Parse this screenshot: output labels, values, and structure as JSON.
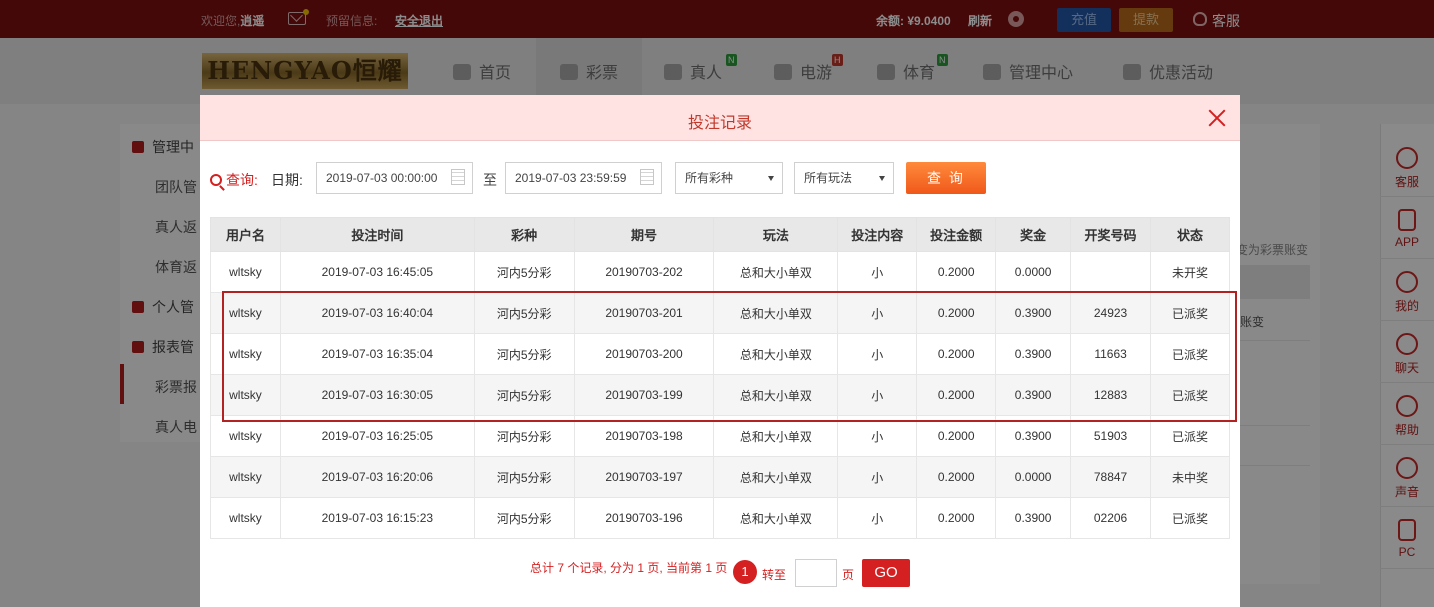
{
  "topbar": {
    "welcome": "欢迎您,",
    "username": "逍遥",
    "notice_label": "预留信息:",
    "logout": "安全退出",
    "balance": "余额: ¥9.0400",
    "refresh": "刷新",
    "recharge": "充值",
    "withdraw": "提款",
    "service": "客服"
  },
  "nav": {
    "logo": "HENGYAO恒耀",
    "items": [
      {
        "label": "首页",
        "icon": "home-icon"
      },
      {
        "label": "彩票",
        "icon": "lottery-ticket-icon"
      },
      {
        "label": "真人",
        "icon": "live-dealer-icon",
        "badge": "N"
      },
      {
        "label": "电游",
        "icon": "game-console-icon",
        "badge": "H"
      },
      {
        "label": "体育",
        "icon": "trophy-icon",
        "badge": "N"
      },
      {
        "label": "管理中心",
        "icon": "users-icon"
      },
      {
        "label": "优惠活动",
        "icon": "gift-icon"
      }
    ]
  },
  "background": {
    "side": [
      "管理中",
      "团队管",
      "真人返",
      "体育返",
      "个人管",
      "报表管",
      "彩票报",
      "真人电"
    ],
    "main_fragments": [
      "变为彩票账变",
      "账变"
    ]
  },
  "dock": [
    {
      "label": "客服",
      "icon": "customer-service-icon"
    },
    {
      "label": "APP",
      "icon": "phone-icon"
    },
    {
      "label": "我的",
      "icon": "user-icon"
    },
    {
      "label": "聊天",
      "icon": "chat-icon"
    },
    {
      "label": "帮助",
      "icon": "help-icon"
    },
    {
      "label": "声音",
      "icon": "speaker-icon"
    },
    {
      "label": "PC",
      "icon": "monitor-icon"
    }
  ],
  "modal": {
    "title": "投注记录",
    "filters": {
      "query_label": "查询:",
      "date_label": "日期:",
      "start_date": "2019-07-03 00:00:00",
      "to_label": "至",
      "end_date": "2019-07-03 23:59:59",
      "lottery_type": "所有彩种",
      "play_type": "所有玩法",
      "submit": "查 询"
    },
    "table": {
      "headers": [
        "用户名",
        "投注时间",
        "彩种",
        "期号",
        "玩法",
        "投注内容",
        "投注金额",
        "奖金",
        "开奖号码",
        "状态"
      ],
      "rows": [
        [
          "wltsky",
          "2019-07-03 16:45:05",
          "河内5分彩",
          "20190703-202",
          "总和大小单双",
          "小",
          "0.2000",
          "0.0000",
          "",
          "未开奖"
        ],
        [
          "wltsky",
          "2019-07-03 16:40:04",
          "河内5分彩",
          "20190703-201",
          "总和大小单双",
          "小",
          "0.2000",
          "0.3900",
          "24923",
          "已派奖"
        ],
        [
          "wltsky",
          "2019-07-03 16:35:04",
          "河内5分彩",
          "20190703-200",
          "总和大小单双",
          "小",
          "0.2000",
          "0.3900",
          "11663",
          "已派奖"
        ],
        [
          "wltsky",
          "2019-07-03 16:30:05",
          "河内5分彩",
          "20190703-199",
          "总和大小单双",
          "小",
          "0.2000",
          "0.3900",
          "12883",
          "已派奖"
        ],
        [
          "wltsky",
          "2019-07-03 16:25:05",
          "河内5分彩",
          "20190703-198",
          "总和大小单双",
          "小",
          "0.2000",
          "0.3900",
          "51903",
          "已派奖"
        ],
        [
          "wltsky",
          "2019-07-03 16:20:06",
          "河内5分彩",
          "20190703-197",
          "总和大小单双",
          "小",
          "0.2000",
          "0.0000",
          "78847",
          "未中奖"
        ],
        [
          "wltsky",
          "2019-07-03 16:15:23",
          "河内5分彩",
          "20190703-196",
          "总和大小单双",
          "小",
          "0.2000",
          "0.3900",
          "02206",
          "已派奖"
        ]
      ]
    },
    "pager": {
      "summary": "总计 7 个记录, 分为 1 页, 当前第 1 页",
      "current_page": "1",
      "goto_label": "转至",
      "page_unit": "页",
      "go": "GO"
    }
  },
  "colors": {
    "brand_red": "#7d1010",
    "accent_red": "#d42020",
    "status_paid": "#d42020",
    "status_pending": "#1e8c1e",
    "status_lost": "#888888"
  }
}
